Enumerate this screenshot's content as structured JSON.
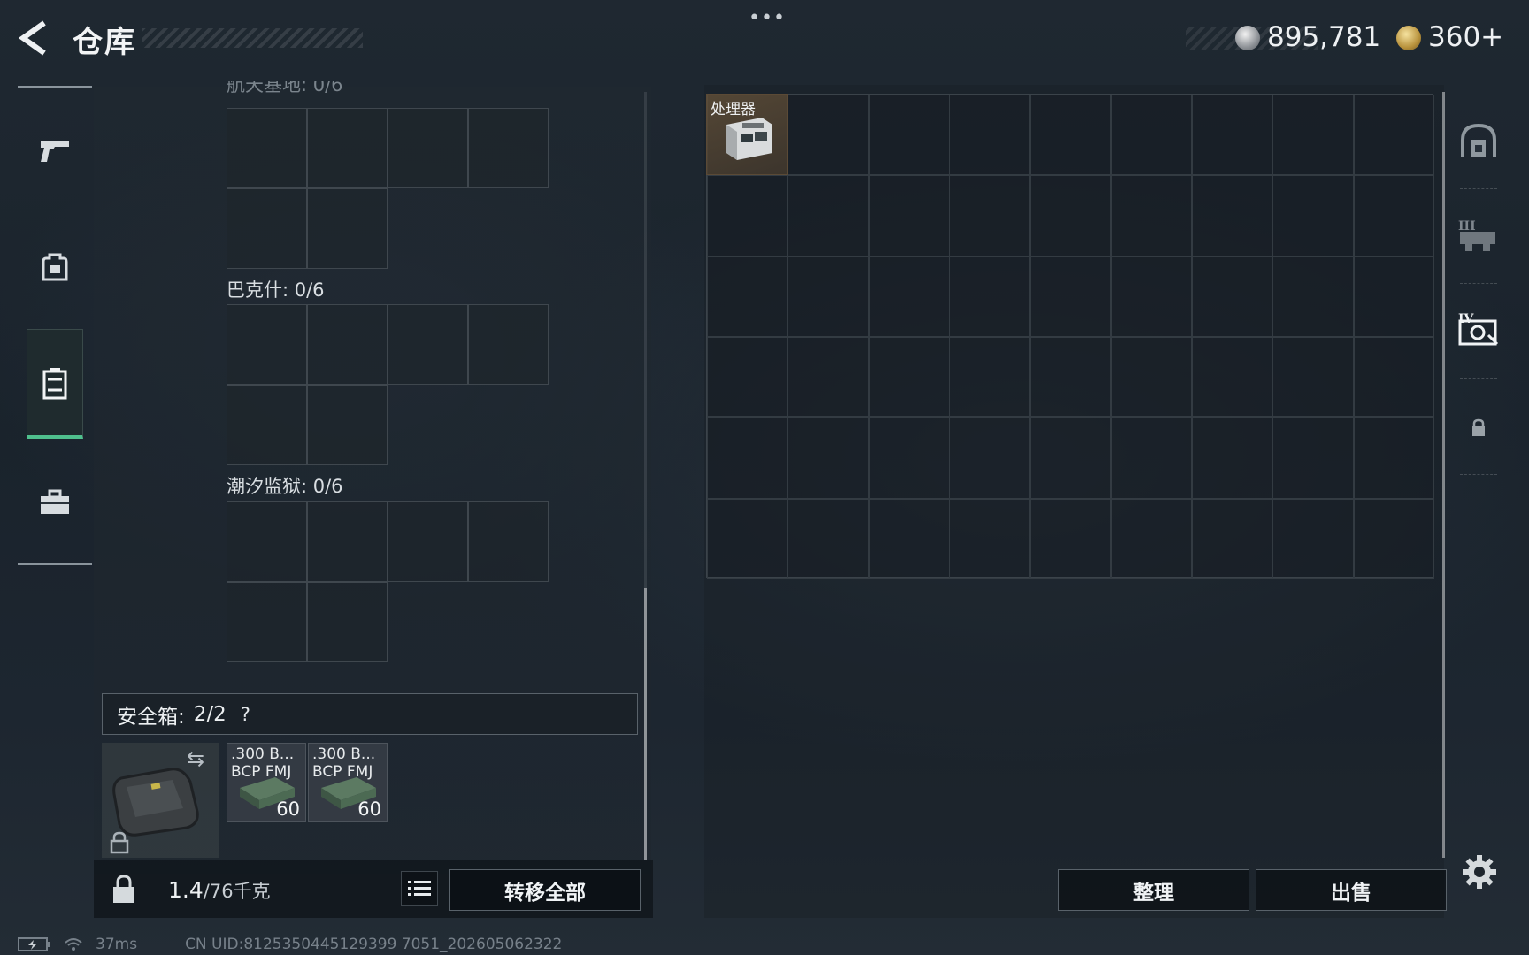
{
  "header": {
    "title": "仓库",
    "more_label": "•••",
    "currency": {
      "silver": "895,781",
      "gold": "360",
      "gold_add": "+"
    },
    "tiny_text": "ᴬᴬᴬ ᴬᴬᴬ"
  },
  "left_rail": {
    "items": [
      {
        "name": "weapons",
        "icon": "pistol-icon"
      },
      {
        "name": "equipment",
        "icon": "backpack-icon"
      },
      {
        "name": "containers",
        "icon": "container-icon",
        "active": true
      },
      {
        "name": "tools",
        "icon": "toolbox-icon"
      }
    ]
  },
  "containers": {
    "sections": [
      {
        "label": "航天基地: 0/6"
      },
      {
        "label": "巴克什: 0/6"
      },
      {
        "label": "潮汐监狱: 0/6"
      }
    ]
  },
  "safe_box": {
    "label": "安全箱:",
    "count": "2/2",
    "help": "?",
    "items": [
      {
        "name": ".300 B...\nBCP FMJ",
        "count": "60"
      },
      {
        "name": ".300 B...\nBCP FMJ",
        "count": "60"
      }
    ]
  },
  "bottom_bar": {
    "weight_current": "1.4",
    "weight_max": "/76千克",
    "transfer_all": "转移全部"
  },
  "stash": {
    "items": [
      {
        "name": "处理器"
      }
    ],
    "sort": "整理",
    "sell": "出售"
  },
  "right_tabs": [
    {
      "name": "stash-tab-1",
      "icon": "vault-icon"
    },
    {
      "name": "stash-tab-3",
      "icon": "expansion-iii-icon"
    },
    {
      "name": "stash-tab-4",
      "icon": "expansion-iv-icon"
    },
    {
      "name": "stash-tab-locked",
      "icon": "lock-icon"
    }
  ],
  "status_bar": {
    "ping": "37ms",
    "uid": "CN UID:8125350445129399 7051_202605062322"
  }
}
